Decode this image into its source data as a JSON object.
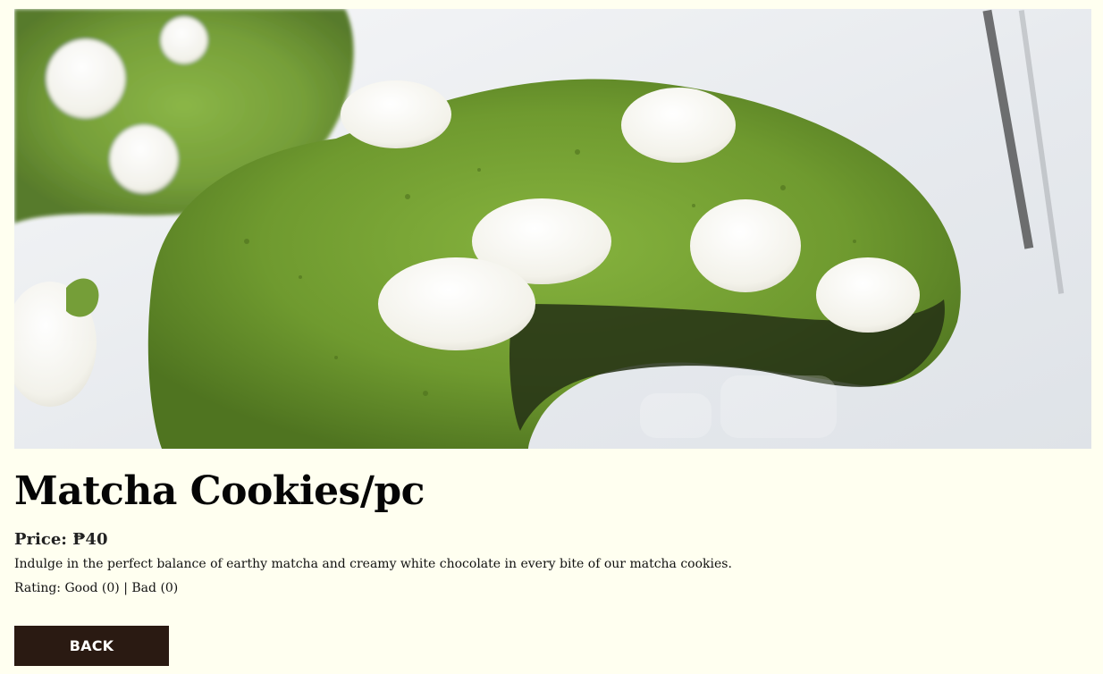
{
  "product": {
    "image_alt": "Matcha cookie with white chocolate chips",
    "title": "Matcha Cookies/pc",
    "price_label": "Price:",
    "price_value": "₱40",
    "description": "Indulge in the perfect balance of earthy matcha and creamy white chocolate in every bite of our matcha cookies.",
    "rating_label": "Rating:",
    "rating_good": "Good (0)",
    "rating_separator": "|",
    "rating_bad": "Bad (0)"
  },
  "actions": {
    "back_label": "BACK"
  },
  "colors": {
    "background": "#fffff0",
    "button_bg": "#2a1a12",
    "button_text": "#ffffff",
    "matcha_green": "#6f9a2f"
  }
}
